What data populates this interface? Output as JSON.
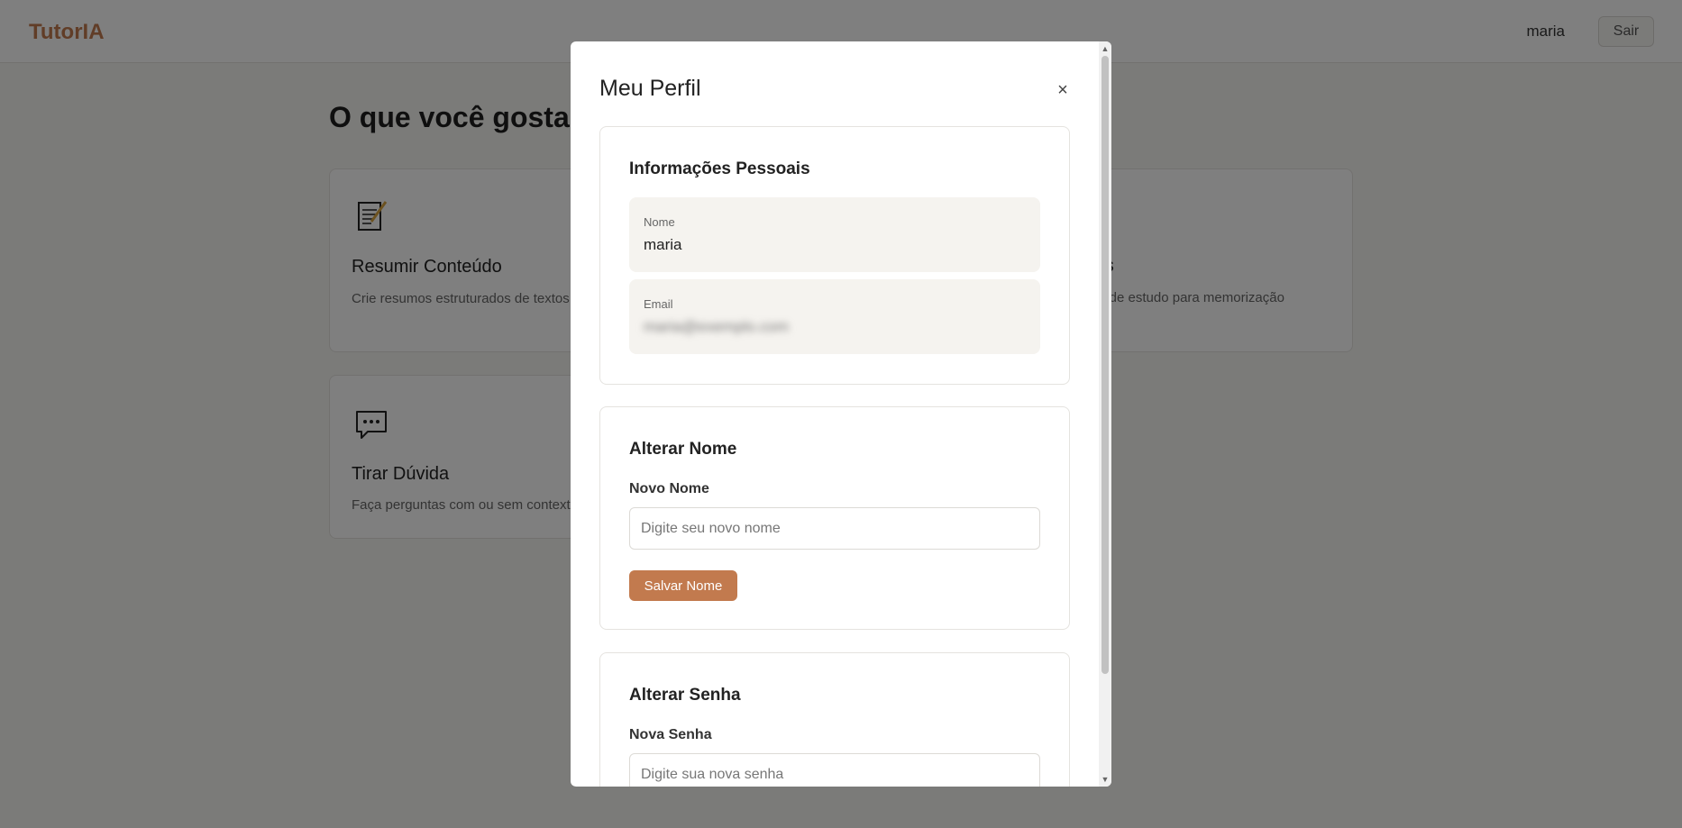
{
  "header": {
    "brand": "TutorIA",
    "username": "maria",
    "logout_label": "Sair"
  },
  "main": {
    "title": "O que você gostar",
    "cards": [
      {
        "icon": "memo-icon",
        "title": "Resumir Conteúdo",
        "description": "Crie resumos estruturados de textos"
      },
      {
        "icon": "speech-bubble-icon",
        "title": "Tirar Dúvida",
        "description": "Faça perguntas com ou sem context"
      }
    ],
    "flashcards": {
      "title_fragment": "rds",
      "description_fragment": "s de estudo para memorização"
    }
  },
  "modal": {
    "title": "Meu Perfil",
    "close_label": "×",
    "personal_info": {
      "title": "Informações Pessoais",
      "name_label": "Nome",
      "name_value": "maria",
      "email_label": "Email",
      "email_value": "maria@exemplo.com"
    },
    "change_name": {
      "title": "Alterar Nome",
      "field_label": "Novo Nome",
      "placeholder": "Digite seu novo nome",
      "button_label": "Salvar Nome"
    },
    "change_password": {
      "title": "Alterar Senha",
      "field_label": "Nova Senha",
      "placeholder": "Digite sua nova senha"
    }
  },
  "colors": {
    "accent": "#c27a4e",
    "overlay": "rgba(0,0,0,0.5)"
  }
}
